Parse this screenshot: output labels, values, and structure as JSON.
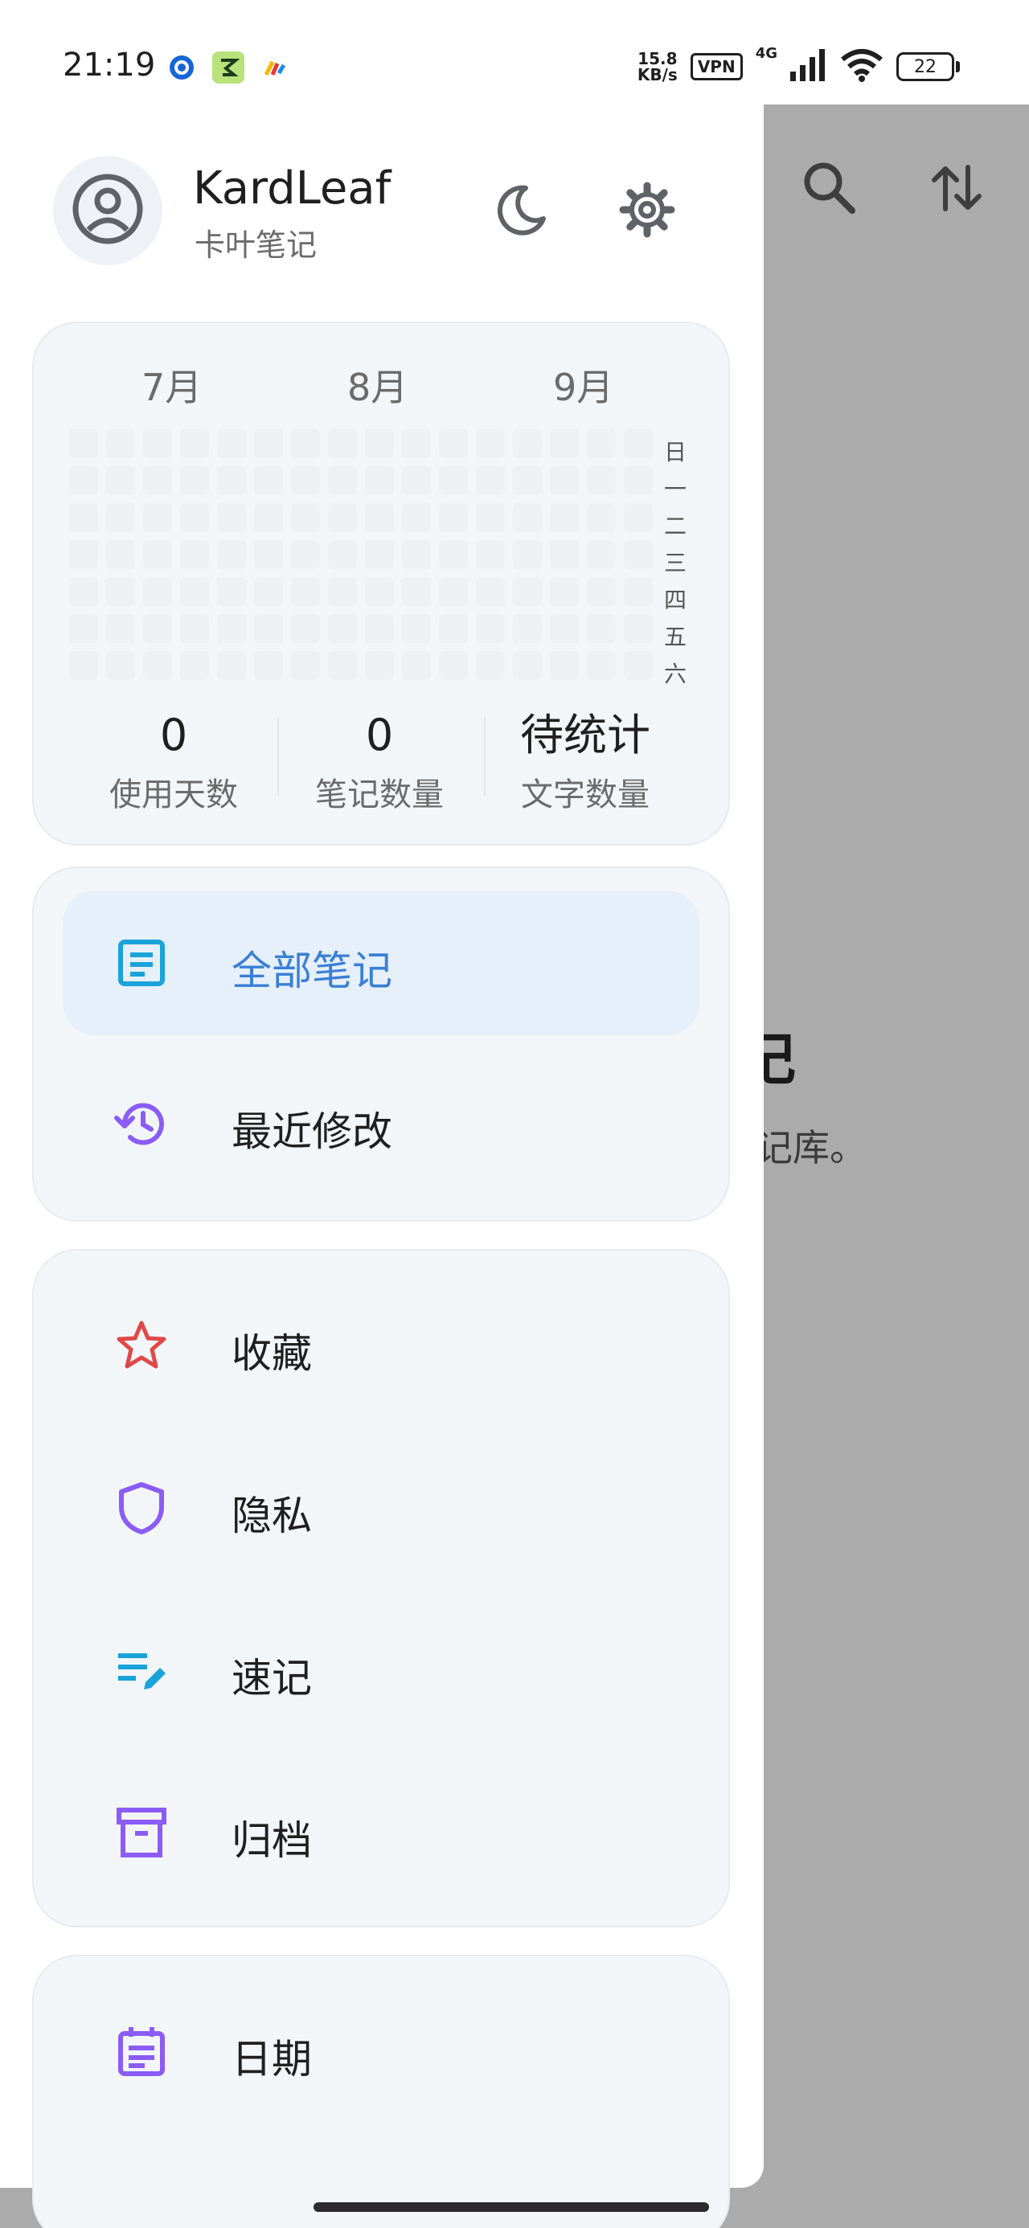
{
  "status_bar": {
    "time": "21:19",
    "net_speed_value": "15.8",
    "net_speed_unit": "KB/s",
    "vpn": "VPN",
    "network": "4G",
    "battery": "22"
  },
  "background": {
    "title_partial": "记",
    "subtitle_partial": "记库。"
  },
  "drawer": {
    "app_name": "KardLeaf",
    "app_subtitle": "卡叶笔记",
    "heatmap": {
      "months": [
        "7月",
        "8月",
        "9月"
      ],
      "weekdays": [
        "日",
        "一",
        "二",
        "三",
        "四",
        "五",
        "六"
      ]
    },
    "stats": [
      {
        "value": "0",
        "label": "使用天数"
      },
      {
        "value": "0",
        "label": "笔记数量"
      },
      {
        "value": "待统计",
        "label": "文字数量"
      }
    ],
    "nav_primary": [
      {
        "label": "全部笔记",
        "icon": "notes-icon",
        "active": true
      },
      {
        "label": "最近修改",
        "icon": "history-icon",
        "active": false
      }
    ],
    "nav_secondary": [
      {
        "label": "收藏",
        "icon": "star-icon"
      },
      {
        "label": "隐私",
        "icon": "shield-icon"
      },
      {
        "label": "速记",
        "icon": "quick-note-icon"
      },
      {
        "label": "归档",
        "icon": "archive-icon"
      }
    ],
    "nav_tertiary": [
      {
        "label": "日期",
        "icon": "calendar-icon"
      }
    ]
  },
  "colors": {
    "accent_blue": "#3a7fd5",
    "icon_cyan": "#1aa3d9",
    "icon_purple": "#8b5cf6",
    "icon_red": "#e04848",
    "scrim": "#ababab"
  }
}
